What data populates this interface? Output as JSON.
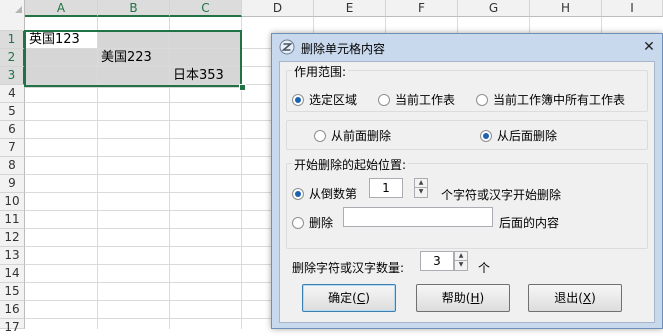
{
  "sheet": {
    "columns": [
      "A",
      "B",
      "C",
      "D",
      "E",
      "F",
      "G",
      "H",
      "I"
    ],
    "rows": [
      "1",
      "2",
      "3",
      "4",
      "5",
      "6",
      "7",
      "8",
      "9",
      "10",
      "11",
      "12",
      "13",
      "14",
      "15",
      "16",
      "17",
      "18"
    ],
    "cells": {
      "A1": "英国123",
      "B2": "美国223",
      "C3": "日本353"
    }
  },
  "dialog": {
    "title": "删除单元格内容",
    "close_glyph": "✕",
    "scope": {
      "label": "作用范围:",
      "options": [
        "选定区域",
        "当前工作表",
        "当前工作簿中所有工作表"
      ],
      "selected": "选定区域"
    },
    "direction": {
      "options": [
        "从前面删除",
        "从后面删除"
      ],
      "selected": "从后面删除"
    },
    "start": {
      "label": "开始删除的起始位置:",
      "option1_prefix": "从倒数第",
      "option1_value": "1",
      "option1_suffix": "个字符或汉字开始删除",
      "option2_prefix": "删除",
      "option2_value": "",
      "option2_suffix": "后面的内容",
      "selected": "option1"
    },
    "count": {
      "label": "删除字符或汉字数量:",
      "value": "3",
      "unit": "个"
    },
    "buttons": {
      "ok": "确定",
      "ok_key": "C",
      "help": "帮助",
      "help_key": "H",
      "exit": "退出",
      "exit_key": "X"
    }
  }
}
